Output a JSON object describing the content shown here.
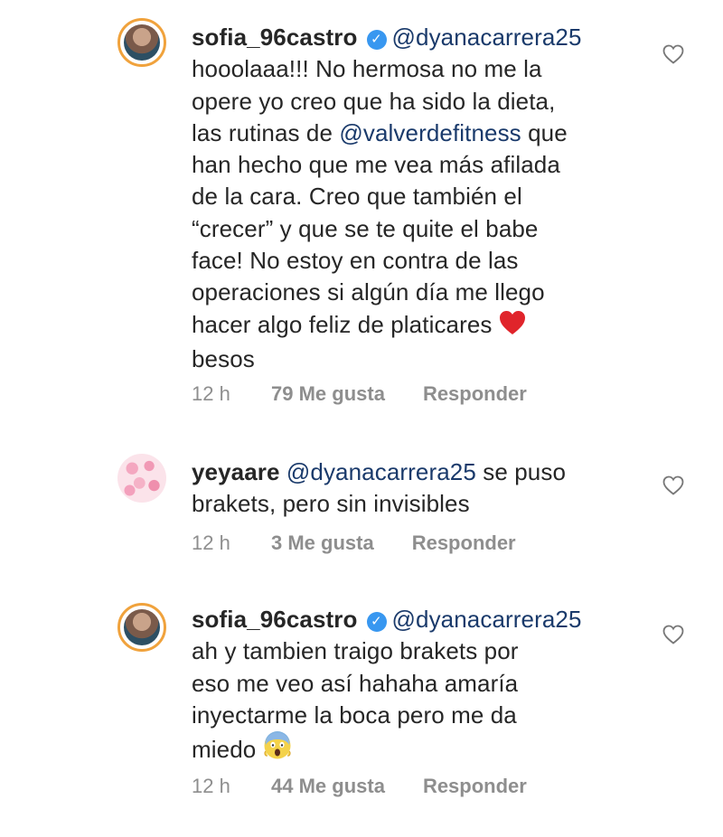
{
  "comments": [
    {
      "username": "sofia_96castro",
      "verified": true,
      "avatar": "profile-photo",
      "mention": "@dyanacarrera25",
      "lines": [
        [
          {
            "t": "hooolaaa!!! No hermosa no me la"
          }
        ],
        [
          {
            "t": "opere yo creo que ha sido la dieta,"
          }
        ],
        [
          {
            "t": "las rutinas de "
          },
          {
            "t": "@valverdefitness",
            "m": true
          },
          {
            "t": " que"
          }
        ],
        [
          {
            "t": "han hecho que me vea más afilada"
          }
        ],
        [
          {
            "t": "de la cara. Creo que también el"
          }
        ],
        [
          {
            "t": "“crecer” y que se te quite el babe"
          }
        ],
        [
          {
            "t": "face! No estoy en contra de las"
          }
        ],
        [
          {
            "t": "operaciones si algún día me llego"
          }
        ],
        [
          {
            "t": "hacer algo feliz de platicares "
          },
          {
            "e": "red-heart"
          }
        ],
        [
          {
            "t": "besos"
          }
        ]
      ],
      "time": "12 h",
      "likes": "79 Me gusta",
      "reply": "Responder"
    },
    {
      "username": "yeyaare",
      "verified": false,
      "avatar": "hearts-pattern",
      "mention": "@dyanacarrera25",
      "lines": [
        [
          {
            "t": " se puso"
          }
        ],
        [
          {
            "t": "brakets, pero sin invisibles"
          }
        ]
      ],
      "time": "12 h",
      "likes": "3 Me gusta",
      "reply": "Responder"
    },
    {
      "username": "sofia_96castro",
      "verified": true,
      "avatar": "profile-photo",
      "mention": "@dyanacarrera25",
      "lines": [
        [
          {
            "t": "ah y tambien traigo brakets por"
          }
        ],
        [
          {
            "t": "eso me veo así hahaha amaría"
          }
        ],
        [
          {
            "t": "inyectarme la boca pero me da"
          }
        ],
        [
          {
            "t": "miedo "
          },
          {
            "e": "scream-face"
          }
        ]
      ],
      "time": "12 h",
      "likes": "44 Me gusta",
      "reply": "Responder"
    }
  ],
  "icons": {
    "verified": "verified-badge-icon",
    "like": "heart-outline-icon"
  },
  "colors": {
    "text": "#262626",
    "mention": "#1a3a6b",
    "meta": "#8e8e8e",
    "verified": "#3897f0",
    "story_ring": "#f0a23c"
  }
}
